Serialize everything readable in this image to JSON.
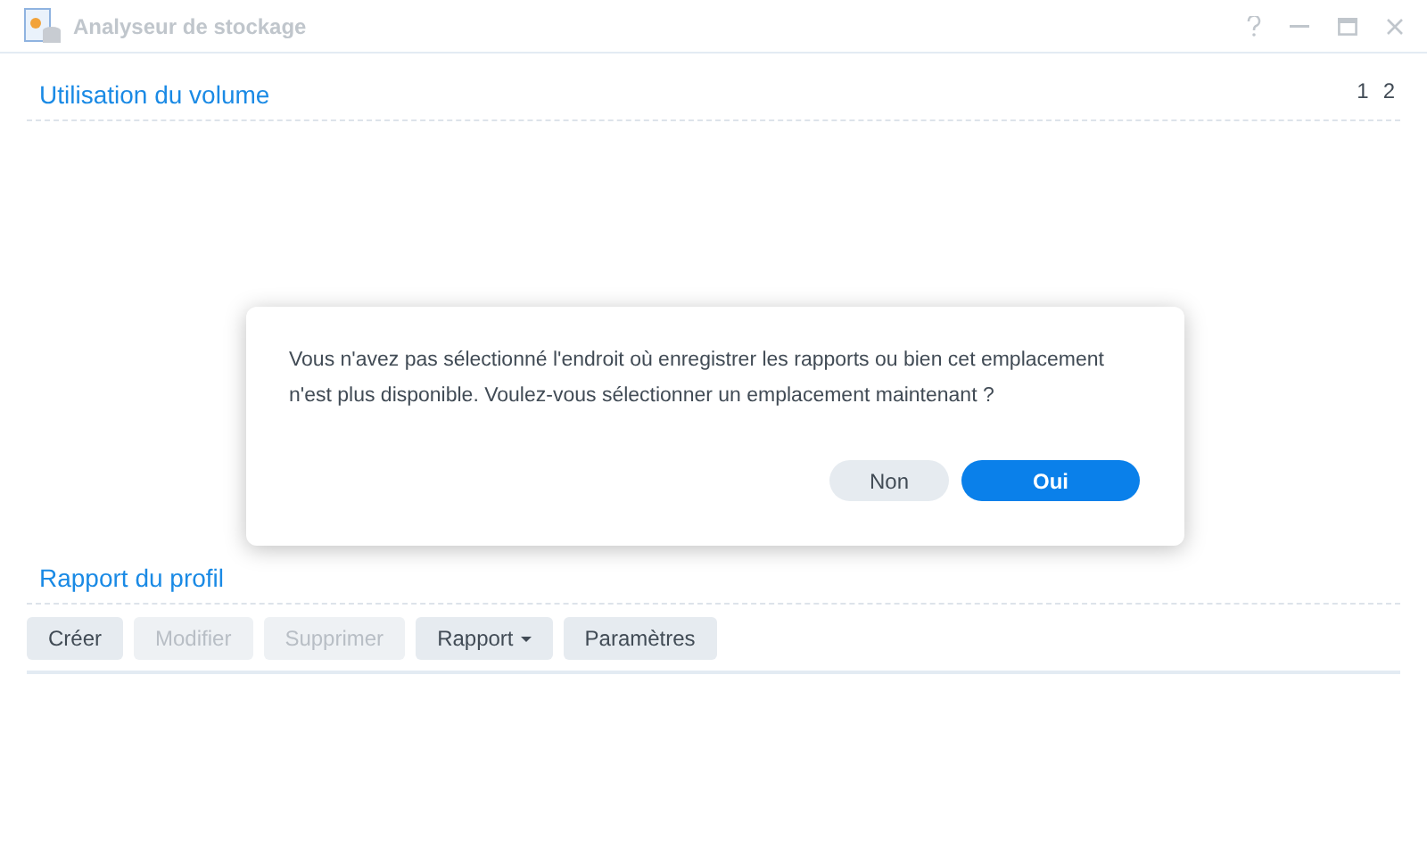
{
  "window": {
    "title": "Analyseur de stockage"
  },
  "pager": [
    "1",
    "2"
  ],
  "volume_section": {
    "title": "Utilisation du volume"
  },
  "profile_section": {
    "title": "Rapport du profil",
    "buttons": [
      {
        "label": "Créer",
        "disabled": false,
        "dropdown": false
      },
      {
        "label": "Modifier",
        "disabled": true,
        "dropdown": false
      },
      {
        "label": "Supprimer",
        "disabled": true,
        "dropdown": false
      },
      {
        "label": "Rapport",
        "disabled": false,
        "dropdown": true
      },
      {
        "label": "Paramètres",
        "disabled": false,
        "dropdown": false
      }
    ]
  },
  "dialog": {
    "message": "Vous n'avez pas sélectionné l'endroit où enregistrer les rapports ou bien cet emplacement n'est plus disponible. Voulez-vous sélectionner un emplacement maintenant ?",
    "buttons": [
      {
        "label": "Non",
        "kind": "secondary"
      },
      {
        "label": "Oui",
        "kind": "primary"
      }
    ]
  }
}
